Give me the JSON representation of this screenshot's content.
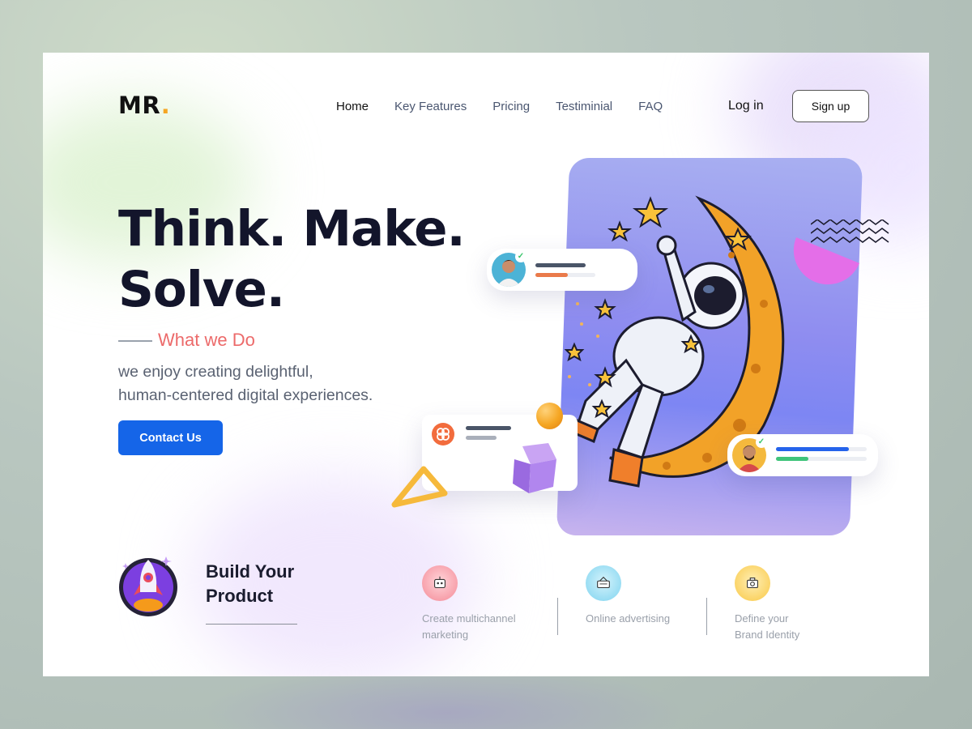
{
  "header": {
    "logo_text": "MR",
    "logo_dot": ".",
    "nav": [
      {
        "label": "Home",
        "active": true
      },
      {
        "label": "Key Features",
        "active": false
      },
      {
        "label": "Pricing",
        "active": false
      },
      {
        "label": "Testiminial",
        "active": false
      },
      {
        "label": "FAQ",
        "active": false
      }
    ],
    "login_label": "Log in",
    "signup_label": "Sign up"
  },
  "hero": {
    "headline_line1": "Think. Make.",
    "headline_line2": "Solve.",
    "eyebrow": "What we Do",
    "description_line1": "we enjoy creating delightful,",
    "description_line2": "human-centered digital experiences.",
    "cta_label": "Contact Us"
  },
  "bottom": {
    "build_line1": "Build Your",
    "build_line2": "Product",
    "features": [
      {
        "icon": "marketing-icon",
        "line1": "Create multichannel",
        "line2": "marketing",
        "color": "#f48a97"
      },
      {
        "icon": "advertising-icon",
        "line1": "Online advertising",
        "line2": "",
        "color": "#7ed3ef"
      },
      {
        "icon": "brand-identity-icon",
        "line1": "Define your",
        "line2": "Brand Identity",
        "color": "#f9c845"
      }
    ]
  },
  "colors": {
    "accent_blue": "#1565e8",
    "accent_coral": "#ec6a6a",
    "logo_dot": "#f5a623",
    "panel_purple": "#8f8df0"
  }
}
